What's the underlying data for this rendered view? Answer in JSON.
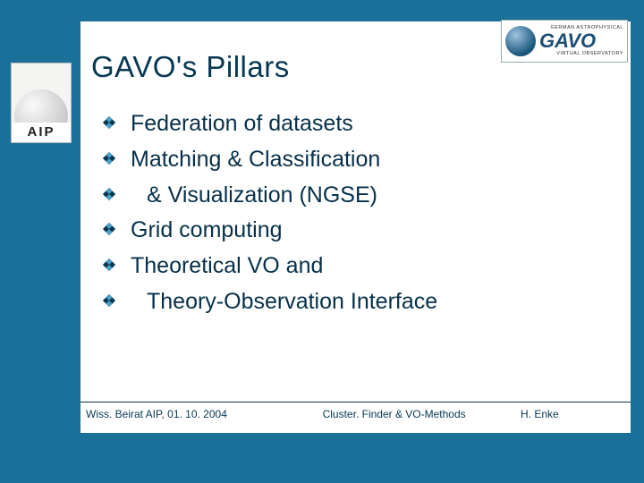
{
  "sidebar": {
    "label": "AIP"
  },
  "badge": {
    "sup": "GERMAN ASTROPHYSICAL",
    "main": "GAVO",
    "sub": "VIRTUAL OBSERVATORY"
  },
  "title": "GAVO's Pillars",
  "bullets": [
    {
      "text": "Federation of datasets",
      "indent": false
    },
    {
      "text": "Matching & Classification",
      "indent": false
    },
    {
      "text": "& Visualization (NGSE)",
      "indent": true
    },
    {
      "text": "Grid computing",
      "indent": false
    },
    {
      "text": "Theoretical VO and",
      "indent": false
    },
    {
      "text": "Theory-Observation Interface",
      "indent": true
    }
  ],
  "footer": {
    "left": "Wiss. Beirat AIP, 01. 10. 2004",
    "mid": "Cluster. Finder & VO-Methods",
    "right": "H. Enke"
  },
  "colors": {
    "background": "#1b7099",
    "text": "#073852"
  }
}
